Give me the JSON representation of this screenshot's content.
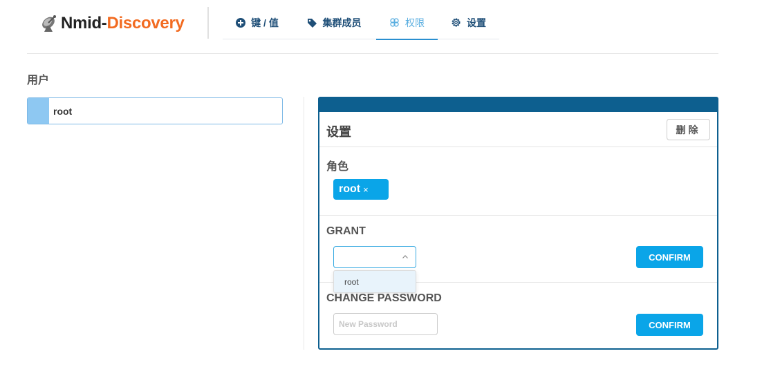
{
  "brand": {
    "name_part1": "Nmid-",
    "name_part2": "Discovery",
    "accent": "#f26b21"
  },
  "nav": {
    "tabs": [
      {
        "label": "键 / 值",
        "icon": "plus-circle-icon"
      },
      {
        "label": "集群成员",
        "icon": "tag-icon"
      },
      {
        "label": "权限",
        "icon": "flower-icon",
        "active": true
      },
      {
        "label": "设置",
        "icon": "gear-icon"
      }
    ]
  },
  "users": {
    "title": "用户",
    "items": [
      {
        "name": "root",
        "selected": true
      }
    ]
  },
  "panel": {
    "title": "设置",
    "delete_label": "删除",
    "role": {
      "label": "角色",
      "tags": [
        {
          "name": "root",
          "remove": "×"
        }
      ]
    },
    "grant": {
      "label": "GRANT",
      "selected_value": "",
      "options": [
        "root"
      ],
      "confirm_label": "CONFIRM"
    },
    "password": {
      "label": "CHANGE PASSWORD",
      "placeholder": "New Password",
      "confirm_label": "CONFIRM"
    }
  },
  "colors": {
    "primary": "#0aa5e8",
    "panel_border": "#0d5f8f",
    "nav_text": "#1f4f78"
  }
}
